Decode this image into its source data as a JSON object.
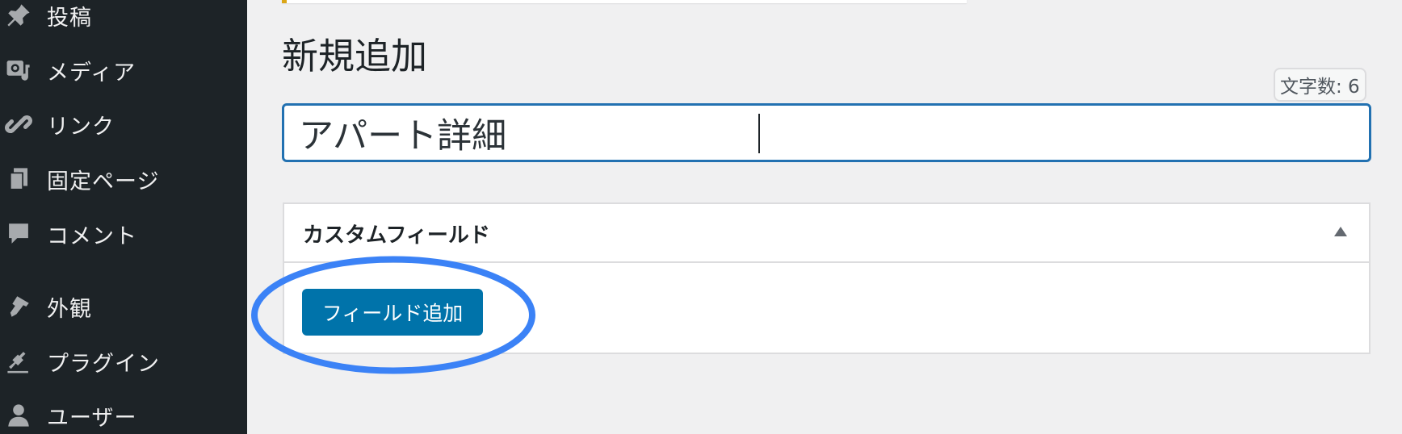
{
  "sidebar": {
    "items": [
      {
        "label": "投稿",
        "icon": "pin-icon"
      },
      {
        "label": "メディア",
        "icon": "media-icon"
      },
      {
        "label": "リンク",
        "icon": "link-icon"
      },
      {
        "label": "固定ページ",
        "icon": "pages-icon"
      },
      {
        "label": "コメント",
        "icon": "comment-icon"
      },
      {
        "label": "外観",
        "icon": "appearance-icon"
      },
      {
        "label": "プラグイン",
        "icon": "plugin-icon"
      },
      {
        "label": "ユーザー",
        "icon": "user-icon"
      }
    ]
  },
  "page": {
    "title": "新規追加"
  },
  "editor": {
    "char_count": "文字数: 6",
    "title_value": "アパート詳細"
  },
  "custom_fields": {
    "title": "カスタムフィールド",
    "add_button": "フィールド追加"
  },
  "colors": {
    "sidebar_bg": "#1d2327",
    "page_bg": "#f0f0f1",
    "primary_button": "#0073aa",
    "input_focus": "#2271b1",
    "highlight_ring": "#3b82f6",
    "notice_accent": "#dba617"
  }
}
